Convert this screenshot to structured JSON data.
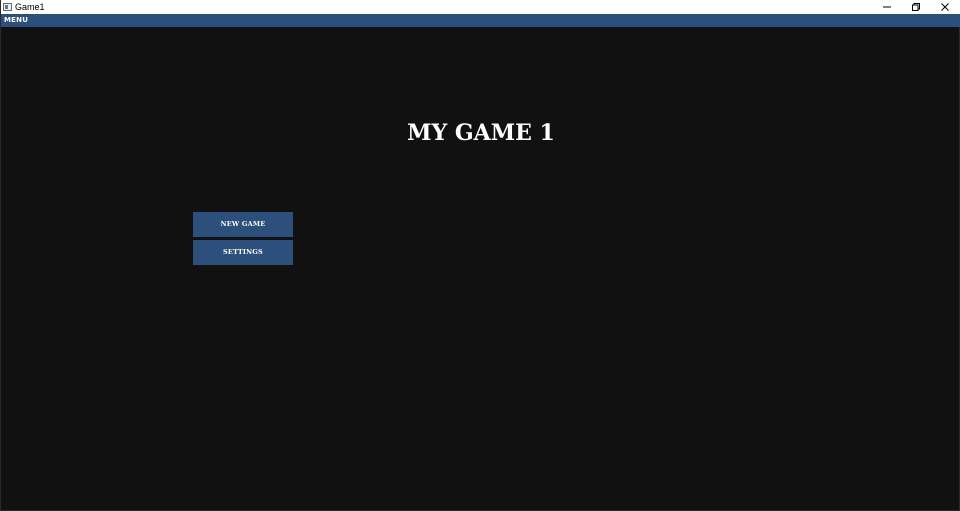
{
  "window": {
    "title": "Game1",
    "icons": {
      "app": "app-window-icon",
      "minimize": "minimize-icon",
      "maximize": "restore-icon",
      "close": "close-icon"
    }
  },
  "menubar": {
    "label": "MENU"
  },
  "game": {
    "title": "MY GAME 1"
  },
  "buttons": {
    "new_game": "NEW GAME",
    "settings": "SETTINGS"
  },
  "colors": {
    "background": "#111111",
    "accent": "#2d4f7c",
    "text": "#ffffff",
    "titlebar": "#ffffff"
  }
}
